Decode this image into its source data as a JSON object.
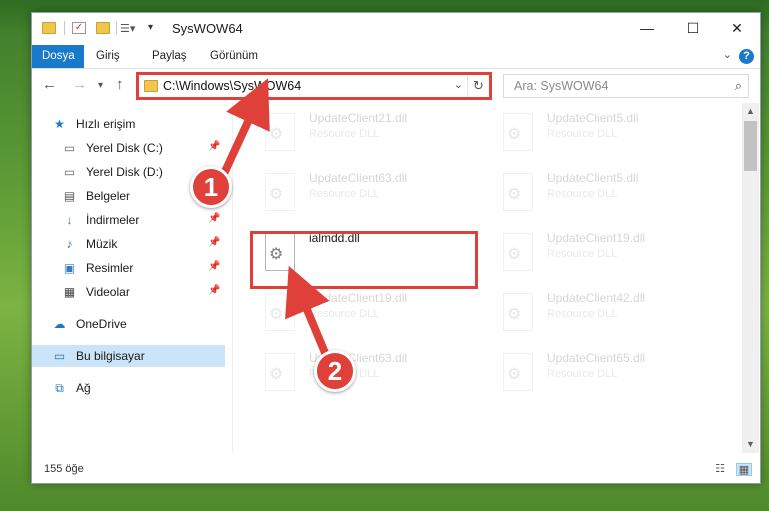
{
  "window": {
    "title": "SysWOW64",
    "controls": {
      "minimize": "—",
      "maximize": "☐",
      "close": "✕"
    }
  },
  "ribbon": {
    "tabs": [
      {
        "label": "Dosya",
        "active": true
      },
      {
        "label": "Giriş"
      },
      {
        "label": "Paylaş"
      },
      {
        "label": "Görünüm"
      }
    ],
    "help": "?"
  },
  "navigation": {
    "address": "C:\\Windows\\SysWOW64",
    "search_placeholder": "Ara: SysWOW64"
  },
  "sidebar": {
    "items": [
      {
        "label": "Hızlı erişim",
        "icon": "star-icon"
      },
      {
        "label": "Yerel Disk (C:)",
        "icon": "drive-icon",
        "pinned": true
      },
      {
        "label": "Yerel Disk (D:)",
        "icon": "drive-icon"
      },
      {
        "label": "Belgeler",
        "icon": "documents-icon",
        "pinned": true
      },
      {
        "label": "İndirmeler",
        "icon": "download-icon",
        "pinned": true
      },
      {
        "label": "Müzik",
        "icon": "music-icon",
        "pinned": true
      },
      {
        "label": "Resimler",
        "icon": "pictures-icon",
        "pinned": true
      },
      {
        "label": "Videolar",
        "icon": "video-icon",
        "pinned": true
      },
      {
        "label": "OneDrive",
        "icon": "cloud-icon"
      },
      {
        "label": "Bu bilgisayar",
        "icon": "computer-icon",
        "selected": true
      },
      {
        "label": "Ağ",
        "icon": "network-icon"
      }
    ]
  },
  "files": [
    {
      "name": "UpdateClient21.dll",
      "type": "Resource DLL",
      "faded": true
    },
    {
      "name": "UpdateClient5.dll",
      "type": "Resource DLL",
      "faded": true
    },
    {
      "name": "UpdateClient63.dll",
      "type": "Resource DLL",
      "faded": true
    },
    {
      "name": "UpdateClient5.dll",
      "type": "Resource DLL",
      "faded": true
    },
    {
      "name": "ialmdd.dll",
      "type": "",
      "faded": false
    },
    {
      "name": "UpdateClient19.dll",
      "type": "Resource DLL",
      "faded": true
    },
    {
      "name": "UpdateClient19.dll",
      "type": "Resource DLL",
      "faded": true
    },
    {
      "name": "UpdateClient42.dll",
      "type": "Resource DLL",
      "faded": true
    },
    {
      "name": "UpdateClient63.dll",
      "type": "Resource DLL",
      "faded": true
    },
    {
      "name": "UpdateClient65.dll",
      "type": "Resource DLL",
      "faded": true
    }
  ],
  "status": {
    "item_count": "155 öğe"
  },
  "callouts": {
    "step1": "1",
    "step2": "2"
  },
  "colors": {
    "accent": "#1979ca",
    "highlight": "#e0403a",
    "selected": "#cce4f7"
  }
}
